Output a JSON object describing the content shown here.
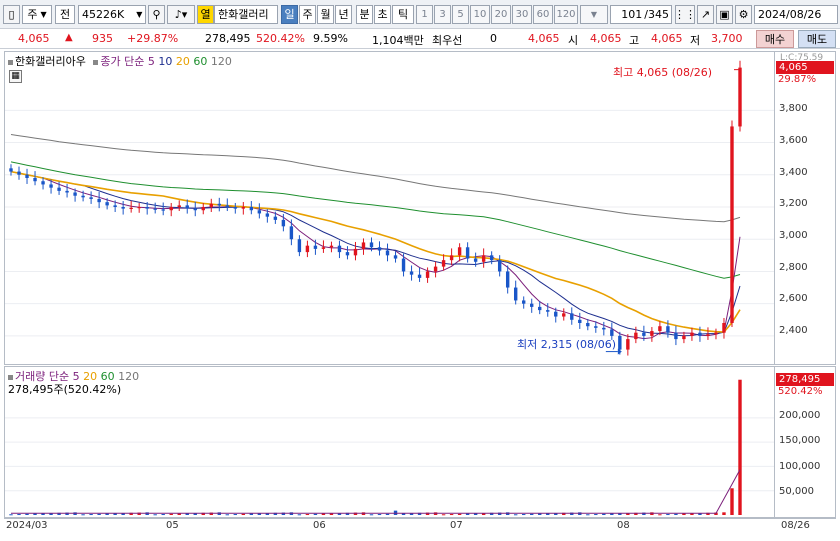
{
  "toolbar": {
    "mode": "주",
    "market": "전",
    "code": "45226K",
    "badge": "열",
    "stock_name": "한화갤러리",
    "periods": [
      "일",
      "주",
      "월",
      "년",
      "분",
      "초",
      "틱"
    ],
    "active_period": "일",
    "intervals": [
      "1",
      "3",
      "5",
      "10",
      "20",
      "30",
      "60",
      "120"
    ],
    "count": "101",
    "count_total": "/345",
    "date": "2024/08/26"
  },
  "quote": {
    "price": "4,065",
    "change": "935",
    "change_pct": "+29.87%",
    "volume": "278,495",
    "volume_ratio": "520.42%",
    "turnover": "9.59%",
    "amount": "1,104백만",
    "instrument": "최우선",
    "zero": "0",
    "ask": "4,065",
    "open_label": "시",
    "open": "4,065",
    "high_label": "고",
    "high": "4,065",
    "low_label": "저",
    "low": "3,700",
    "buy_label": "매수",
    "sell_label": "매도"
  },
  "price_pane": {
    "title": "한화갤러리아우",
    "legend_label": "종가 단순",
    "ma_periods": [
      "5",
      "10",
      "20",
      "60",
      "120"
    ],
    "ma_colors": [
      "#7b1f7b",
      "#1e2f8f",
      "#e8a000",
      "#1f8f2f",
      "#777777"
    ],
    "high_annotation": "최고 4,065 (08/26)",
    "low_annotation": "최저 2,315 (08/06)",
    "last_price": "4,065",
    "last_pct": "29.87%",
    "l_label": "L:C:75.59",
    "y_ticks": [
      "3,800",
      "3,600",
      "3,400",
      "3,200",
      "3,000",
      "2,800",
      "2,600",
      "2,400"
    ]
  },
  "volume_pane": {
    "legend_label": "거래량 단순",
    "ma_periods": [
      "5",
      "20",
      "60",
      "120"
    ],
    "info": "278,495주(520.42%)",
    "last_volume": "278,495",
    "last_pct": "520.42%",
    "y_ticks": [
      "200,000",
      "150,000",
      "100,000",
      "50,000"
    ]
  },
  "x_labels": [
    "2024/03",
    "05",
    "06",
    "07",
    "08",
    "08/26"
  ],
  "colors": {
    "up": "#e0141e",
    "down": "#1a56c8",
    "accent": "#4a7fbf"
  },
  "chart_data": {
    "type": "candlestick",
    "title": "한화갤러리아우",
    "y_range": [
      2300,
      4100
    ],
    "closes": [
      3420,
      3400,
      3380,
      3360,
      3340,
      3320,
      3300,
      3290,
      3270,
      3260,
      3250,
      3230,
      3210,
      3200,
      3190,
      3195,
      3200,
      3190,
      3185,
      3180,
      3200,
      3210,
      3190,
      3180,
      3200,
      3220,
      3210,
      3200,
      3190,
      3200,
      3180,
      3160,
      3140,
      3120,
      3080,
      3000,
      2920,
      2960,
      2940,
      2950,
      2960,
      2920,
      2900,
      2940,
      2980,
      2950,
      2930,
      2900,
      2880,
      2800,
      2780,
      2760,
      2800,
      2830,
      2870,
      2900,
      2950,
      2880,
      2860,
      2900,
      2870,
      2800,
      2700,
      2620,
      2600,
      2580,
      2560,
      2550,
      2520,
      2540,
      2500,
      2480,
      2460,
      2450,
      2440,
      2400,
      2315,
      2380,
      2420,
      2400,
      2430,
      2460,
      2420,
      2380,
      2400,
      2420,
      2400,
      2410,
      2420,
      2480,
      3700,
      4065
    ],
    "volume_max": 278495,
    "last_volume": 278495
  }
}
